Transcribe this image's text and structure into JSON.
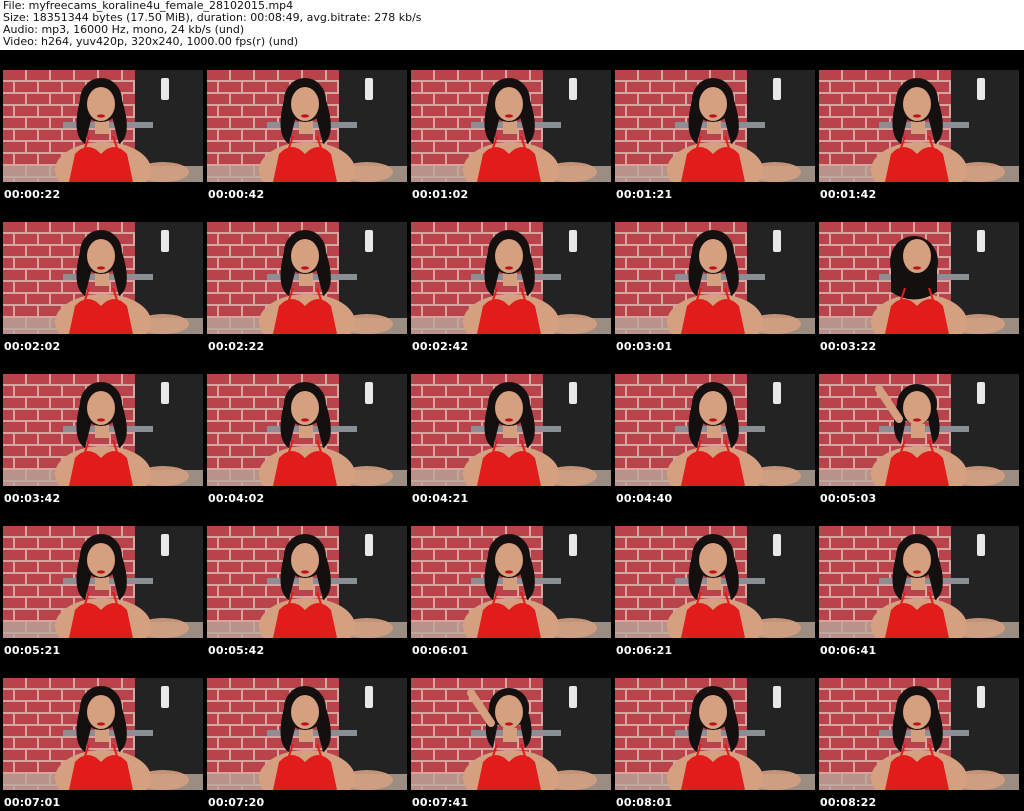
{
  "header": {
    "file_line": "File: myfreecams_koraline4u_female_28102015.mp4",
    "size_line": "Size: 18351344 bytes (17.50 MiB), duration: 00:08:49, avg.bitrate: 278 kb/s",
    "audio_line": "Audio: mp3, 16000 Hz, mono, 24 kb/s (und)",
    "video_line": "Video: h264, yuv420p, 320x240, 1000.00 fps(r) (und)"
  },
  "thumbnails": [
    {
      "timestamp": "00:00:22",
      "hair": "down"
    },
    {
      "timestamp": "00:00:42",
      "hair": "down"
    },
    {
      "timestamp": "00:01:02",
      "hair": "down"
    },
    {
      "timestamp": "00:01:21",
      "hair": "down"
    },
    {
      "timestamp": "00:01:42",
      "hair": "down"
    },
    {
      "timestamp": "00:02:02",
      "hair": "down"
    },
    {
      "timestamp": "00:02:22",
      "hair": "down"
    },
    {
      "timestamp": "00:02:42",
      "hair": "down"
    },
    {
      "timestamp": "00:03:01",
      "hair": "down"
    },
    {
      "timestamp": "00:03:22",
      "hair": "forward"
    },
    {
      "timestamp": "00:03:42",
      "hair": "down"
    },
    {
      "timestamp": "00:04:02",
      "hair": "down"
    },
    {
      "timestamp": "00:04:21",
      "hair": "down"
    },
    {
      "timestamp": "00:04:40",
      "hair": "down"
    },
    {
      "timestamp": "00:05:03",
      "hair": "arm-up"
    },
    {
      "timestamp": "00:05:21",
      "hair": "down"
    },
    {
      "timestamp": "00:05:42",
      "hair": "down"
    },
    {
      "timestamp": "00:06:01",
      "hair": "down"
    },
    {
      "timestamp": "00:06:21",
      "hair": "down"
    },
    {
      "timestamp": "00:06:41",
      "hair": "down"
    },
    {
      "timestamp": "00:07:01",
      "hair": "down"
    },
    {
      "timestamp": "00:07:20",
      "hair": "down"
    },
    {
      "timestamp": "00:07:41",
      "hair": "arm-up"
    },
    {
      "timestamp": "00:08:01",
      "hair": "down"
    },
    {
      "timestamp": "00:08:22",
      "hair": "down"
    }
  ],
  "colors": {
    "sheet_background": "#000000",
    "brick": "#b8434a",
    "mortar": "#d9a4a0",
    "wall_dark": "#232323",
    "skin": "#d4a07f",
    "hair": "#151010",
    "outfit": "#e21b1b",
    "timestamp_text": "#ffffff"
  }
}
